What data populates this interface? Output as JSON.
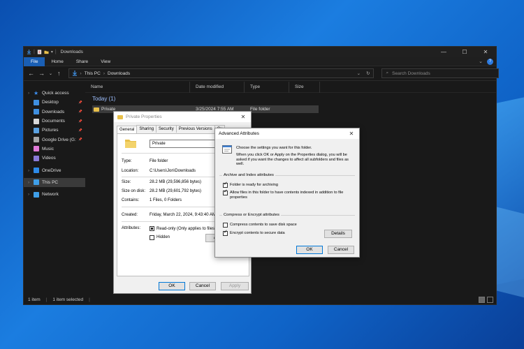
{
  "explorer": {
    "title": "Downloads",
    "ribbon_tabs": [
      "File",
      "Home",
      "Share",
      "View"
    ],
    "address": {
      "root": "This PC",
      "folder": "Downloads"
    },
    "search_placeholder": "Search Downloads",
    "sidebar": [
      {
        "label": "Quick access",
        "icon": "star-icon",
        "color": "#3d8ff0",
        "top": true
      },
      {
        "label": "Desktop",
        "icon": "desktop-icon",
        "color": "#3f8fe0",
        "pin": true
      },
      {
        "label": "Downloads",
        "icon": "download-icon",
        "color": "#3f8fe0",
        "pin": true
      },
      {
        "label": "Documents",
        "icon": "documents-icon",
        "color": "#d8d8d8",
        "pin": true
      },
      {
        "label": "Pictures",
        "icon": "pictures-icon",
        "color": "#5aa0e0",
        "pin": true
      },
      {
        "label": "Google Drive (G:",
        "icon": "drive-icon",
        "color": "#a6a6a6",
        "pin": true
      },
      {
        "label": "Music",
        "icon": "music-icon",
        "color": "#e07ad8"
      },
      {
        "label": "Videos",
        "icon": "videos-icon",
        "color": "#8a7ad8"
      },
      {
        "label": "OneDrive",
        "icon": "cloud-icon",
        "color": "#2d8ae8",
        "top": true
      },
      {
        "label": "This PC",
        "icon": "computer-icon",
        "color": "#3f9fe8",
        "top": true,
        "selected": true
      },
      {
        "label": "Network",
        "icon": "network-icon",
        "color": "#3f9fe8",
        "top": true
      }
    ],
    "columns": [
      "Name",
      "Date modified",
      "Type",
      "Size"
    ],
    "group_label": "Today (1)",
    "file_row": {
      "name": "Private",
      "date": "3/25/2024 7:55 AM",
      "type": "File folder"
    },
    "status": {
      "count": "1 item",
      "selected": "1 item selected"
    }
  },
  "props": {
    "title": "Private Properties",
    "tabs": [
      "General",
      "Sharing",
      "Security",
      "Previous Versions",
      "Cu"
    ],
    "name": "Private",
    "type_k": "Type:",
    "type_v": "File folder",
    "location_k": "Location:",
    "location_v": "C:\\Users\\Jon\\Downloads",
    "size_k": "Size:",
    "size_v": "28.2 MB (29,596,856 bytes)",
    "disk_k": "Size on disk:",
    "disk_v": "28.2 MB (29,601,792 bytes)",
    "contains_k": "Contains:",
    "contains_v": "1 Files, 0 Folders",
    "created_k": "Created:",
    "created_v": "Friday, March 22, 2024, 9:43:40 AM",
    "attributes_k": "Attributes:",
    "readonly": "Read-only (Only applies to files in",
    "hidden": "Hidden",
    "advanced_btn": "A",
    "ok": "OK",
    "cancel": "Cancel",
    "apply": "Apply"
  },
  "adv": {
    "title": "Advanced Attributes",
    "intro1": "Choose the settings you want for this folder.",
    "intro2": "When you click OK or Apply on the Properties dialog, you will be asked if you want the changes to affect all subfolders and files as well.",
    "archive_group": "Archive and Index attributes",
    "archive_opt": "Folder is ready for archiving",
    "index_opt": "Allow files in this folder to have contents indexed in addition to file properties",
    "compress_group": "Compress or Encrypt attributes",
    "compress_opt": "Compress contents to save disk space",
    "encrypt_opt": "Encrypt contents to secure data",
    "details": "Details",
    "ok": "OK",
    "cancel": "Cancel"
  }
}
